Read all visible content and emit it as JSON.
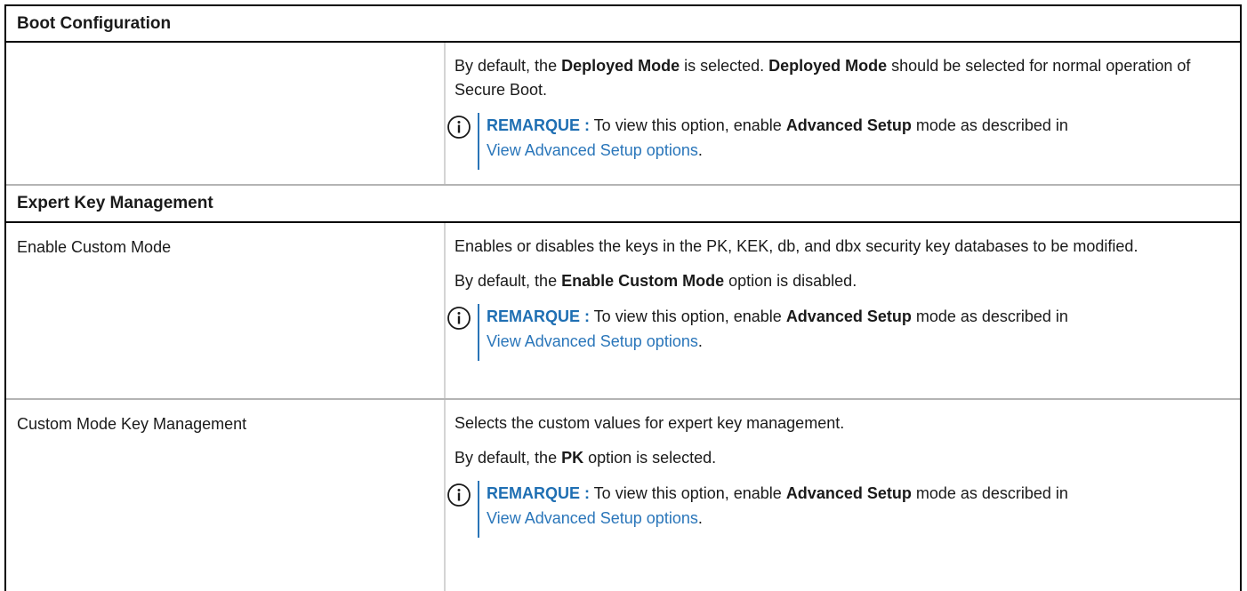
{
  "sections": {
    "boot_configuration": "Boot Configuration",
    "expert_key_management": "Expert Key Management"
  },
  "rows": [
    {
      "name": "",
      "p1": {
        "a": "By default, the ",
        "b": "Deployed Mode",
        "c": " is selected. ",
        "d": "Deployed Mode",
        "e": " should be selected for normal operation of Secure Boot."
      },
      "note": {
        "label": "REMARQUE :",
        "a": " To view this option, enable ",
        "b": "Advanced Setup",
        "c": " mode as described in ",
        "link": "View Advanced Setup options",
        "end": "."
      }
    },
    {
      "name": "Enable Custom Mode",
      "p1": "Enables or disables the keys in the PK, KEK, db, and dbx security key databases to be modified.",
      "p2": {
        "a": "By default, the ",
        "b": "Enable Custom Mode",
        "c": " option is disabled."
      },
      "note": {
        "label": "REMARQUE :",
        "a": " To view this option, enable ",
        "b": "Advanced Setup",
        "c": " mode as described in ",
        "link": "View Advanced Setup options",
        "end": "."
      }
    },
    {
      "name": "Custom Mode Key Management",
      "p1": "Selects the custom values for expert key management.",
      "p2": {
        "a": "By default, the ",
        "b": "PK",
        "c": " option is selected."
      },
      "note": {
        "label": "REMARQUE :",
        "a": " To view this option, enable ",
        "b": "Advanced Setup",
        "c": " mode as described in ",
        "link": "View Advanced Setup options",
        "end": "."
      }
    }
  ],
  "colors": {
    "accent": "#1f6fb3",
    "link": "#2a76ba",
    "border": "#000000",
    "divider": "#b4b4b4"
  }
}
